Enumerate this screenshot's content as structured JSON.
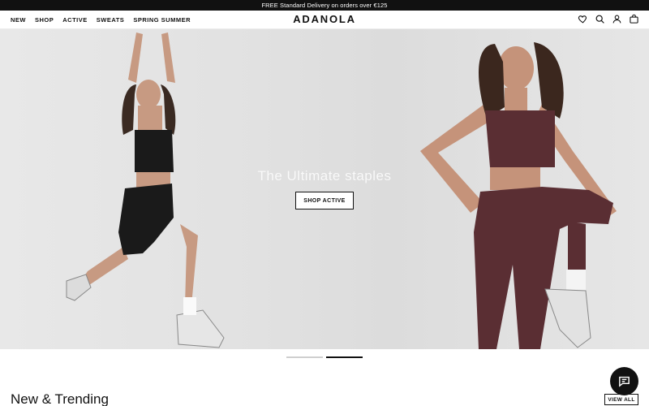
{
  "announcement": "FREE Standard Delivery on orders over €125",
  "nav": [
    {
      "label": "NEW",
      "name": "nav-new"
    },
    {
      "label": "SHOP",
      "name": "nav-shop"
    },
    {
      "label": "ACTIVE",
      "name": "nav-active"
    },
    {
      "label": "SWEATS",
      "name": "nav-sweats"
    },
    {
      "label": "SPRING SUMMER",
      "name": "nav-spring-summer"
    }
  ],
  "brand": "ADANOLA",
  "header_icons": [
    "heart-icon",
    "search-icon",
    "account-icon",
    "bag-icon"
  ],
  "hero": {
    "headline": "The Ultimate staples",
    "button": "SHOP ACTIVE",
    "slides": 2,
    "active_slide": 2
  },
  "section": {
    "title": "New & Trending",
    "view_all": "VIEW ALL"
  },
  "chat_icon": "chat-bubble-icon",
  "colors": {
    "announcement_bg": "#111111",
    "outfit_left": "#1a1a1a",
    "outfit_right": "#5a2e33",
    "hero_bg": "#e3e3e3"
  }
}
